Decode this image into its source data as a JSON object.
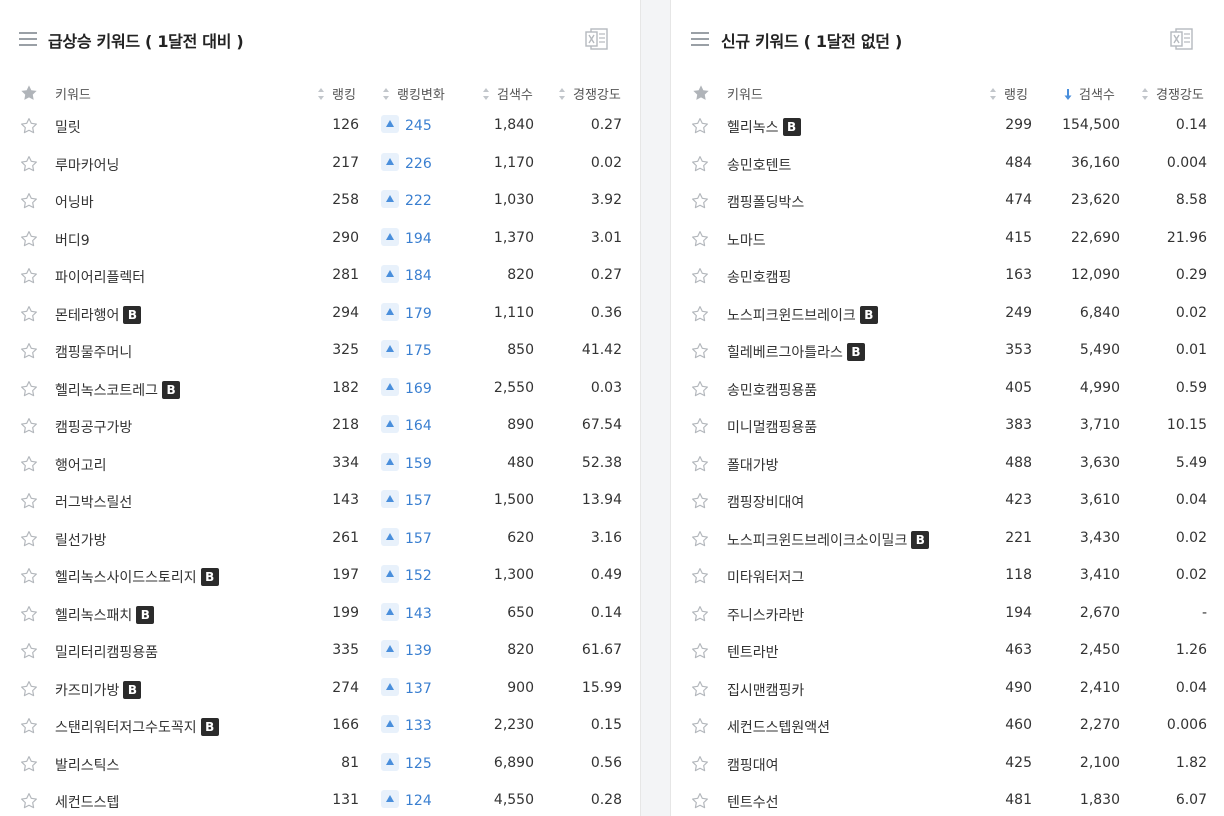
{
  "left": {
    "title": "급상승 키워드 ( 1달전 대비 )",
    "headers": {
      "keyword": "키워드",
      "rank": "랭킹",
      "change": "랭킹변화",
      "search": "검색수",
      "competition": "경쟁강도"
    },
    "rows": [
      {
        "keyword": "밀릿",
        "badge": "",
        "rank": "126",
        "change": "245",
        "search": "1,840",
        "competition": "0.27"
      },
      {
        "keyword": "루마카어닝",
        "badge": "",
        "rank": "217",
        "change": "226",
        "search": "1,170",
        "competition": "0.02"
      },
      {
        "keyword": "어닝바",
        "badge": "",
        "rank": "258",
        "change": "222",
        "search": "1,030",
        "competition": "3.92"
      },
      {
        "keyword": "버디9",
        "badge": "",
        "rank": "290",
        "change": "194",
        "search": "1,370",
        "competition": "3.01"
      },
      {
        "keyword": "파이어리플렉터",
        "badge": "",
        "rank": "281",
        "change": "184",
        "search": "820",
        "competition": "0.27"
      },
      {
        "keyword": "몬테라행어",
        "badge": "B",
        "rank": "294",
        "change": "179",
        "search": "1,110",
        "competition": "0.36"
      },
      {
        "keyword": "캠핑물주머니",
        "badge": "",
        "rank": "325",
        "change": "175",
        "search": "850",
        "competition": "41.42"
      },
      {
        "keyword": "헬리녹스코트레그",
        "badge": "B",
        "rank": "182",
        "change": "169",
        "search": "2,550",
        "competition": "0.03"
      },
      {
        "keyword": "캠핑공구가방",
        "badge": "",
        "rank": "218",
        "change": "164",
        "search": "890",
        "competition": "67.54"
      },
      {
        "keyword": "행어고리",
        "badge": "",
        "rank": "334",
        "change": "159",
        "search": "480",
        "competition": "52.38"
      },
      {
        "keyword": "러그박스릴선",
        "badge": "",
        "rank": "143",
        "change": "157",
        "search": "1,500",
        "competition": "13.94"
      },
      {
        "keyword": "릴선가방",
        "badge": "",
        "rank": "261",
        "change": "157",
        "search": "620",
        "competition": "3.16"
      },
      {
        "keyword": "헬리녹스사이드스토리지",
        "badge": "B",
        "rank": "197",
        "change": "152",
        "search": "1,300",
        "competition": "0.49"
      },
      {
        "keyword": "헬리녹스패치",
        "badge": "B",
        "rank": "199",
        "change": "143",
        "search": "650",
        "competition": "0.14"
      },
      {
        "keyword": "밀리터리캠핑용품",
        "badge": "",
        "rank": "335",
        "change": "139",
        "search": "820",
        "competition": "61.67"
      },
      {
        "keyword": "카즈미가방",
        "badge": "B",
        "rank": "274",
        "change": "137",
        "search": "900",
        "competition": "15.99"
      },
      {
        "keyword": "스탠리워터저그수도꼭지",
        "badge": "B",
        "rank": "166",
        "change": "133",
        "search": "2,230",
        "competition": "0.15"
      },
      {
        "keyword": "발리스틱스",
        "badge": "",
        "rank": "81",
        "change": "125",
        "search": "6,890",
        "competition": "0.56"
      },
      {
        "keyword": "세컨드스텝",
        "badge": "",
        "rank": "131",
        "change": "124",
        "search": "4,550",
        "competition": "0.28"
      }
    ]
  },
  "right": {
    "title": "신규 키워드 ( 1달전 없던 )",
    "headers": {
      "keyword": "키워드",
      "rank": "랭킹",
      "search": "검색수",
      "competition": "경쟁강도"
    },
    "rows": [
      {
        "keyword": "헬리녹스",
        "badge": "B",
        "rank": "299",
        "search": "154,500",
        "competition": "0.14"
      },
      {
        "keyword": "송민호텐트",
        "badge": "",
        "rank": "484",
        "search": "36,160",
        "competition": "0.004"
      },
      {
        "keyword": "캠핑폴딩박스",
        "badge": "",
        "rank": "474",
        "search": "23,620",
        "competition": "8.58"
      },
      {
        "keyword": "노마드",
        "badge": "",
        "rank": "415",
        "search": "22,690",
        "competition": "21.96"
      },
      {
        "keyword": "송민호캠핑",
        "badge": "",
        "rank": "163",
        "search": "12,090",
        "competition": "0.29"
      },
      {
        "keyword": "노스피크윈드브레이크",
        "badge": "B",
        "rank": "249",
        "search": "6,840",
        "competition": "0.02"
      },
      {
        "keyword": "힐레베르그아틀라스",
        "badge": "B",
        "rank": "353",
        "search": "5,490",
        "competition": "0.01"
      },
      {
        "keyword": "송민호캠핑용품",
        "badge": "",
        "rank": "405",
        "search": "4,990",
        "competition": "0.59"
      },
      {
        "keyword": "미니멀캠핑용품",
        "badge": "",
        "rank": "383",
        "search": "3,710",
        "competition": "10.15"
      },
      {
        "keyword": "폴대가방",
        "badge": "",
        "rank": "488",
        "search": "3,630",
        "competition": "5.49"
      },
      {
        "keyword": "캠핑장비대여",
        "badge": "",
        "rank": "423",
        "search": "3,610",
        "competition": "0.04"
      },
      {
        "keyword": "노스피크윈드브레이크소이밀크",
        "badge": "B",
        "rank": "221",
        "search": "3,430",
        "competition": "0.02"
      },
      {
        "keyword": "미타워터저그",
        "badge": "",
        "rank": "118",
        "search": "3,410",
        "competition": "0.02"
      },
      {
        "keyword": "주니스카라반",
        "badge": "",
        "rank": "194",
        "search": "2,670",
        "competition": "-"
      },
      {
        "keyword": "텐트라반",
        "badge": "",
        "rank": "463",
        "search": "2,450",
        "competition": "1.26"
      },
      {
        "keyword": "집시맨캠핑카",
        "badge": "",
        "rank": "490",
        "search": "2,410",
        "competition": "0.04"
      },
      {
        "keyword": "세컨드스텝원액션",
        "badge": "",
        "rank": "460",
        "search": "2,270",
        "competition": "0.006"
      },
      {
        "keyword": "캠핑대여",
        "badge": "",
        "rank": "425",
        "search": "2,100",
        "competition": "1.82"
      },
      {
        "keyword": "텐트수선",
        "badge": "",
        "rank": "481",
        "search": "1,830",
        "competition": "6.07"
      }
    ]
  },
  "icons": {
    "menu": "hamburger-menu-icon",
    "excel": "excel-download-icon",
    "star": "star-outline-icon",
    "star_header": "star-filled-icon",
    "sort": "sort-updown-icon",
    "sort_active": "sort-down-arrow-icon",
    "rank_up": "rank-up-triangle-icon"
  },
  "colors": {
    "accent": "#3a7fd0",
    "badge_bg": "#2b2b2b",
    "up_bg": "#e8f1fb"
  }
}
